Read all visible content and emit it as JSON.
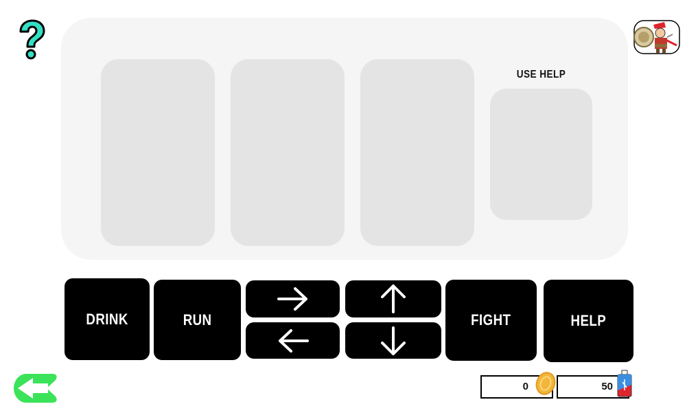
{
  "board": {
    "use_help_label": "USE HELP"
  },
  "actions": {
    "drink": "DRINK",
    "run": "RUN",
    "fight": "FIGHT",
    "help": "HELP"
  },
  "directions": [
    "right-arrow-icon",
    "left-arrow-icon",
    "up-arrow-icon",
    "down-arrow-icon"
  ],
  "resources": {
    "coins": "0",
    "potions": "50"
  },
  "colors": {
    "help_icon": "#33e0c4",
    "back_button": "#3be35a",
    "board_bg": "#f5f5f5",
    "slot_bg": "#e4e4e4",
    "button_bg": "#000000",
    "coin": "#f2b63a",
    "potion_red": "#e0242c",
    "potion_blue": "#3a8fe0"
  }
}
